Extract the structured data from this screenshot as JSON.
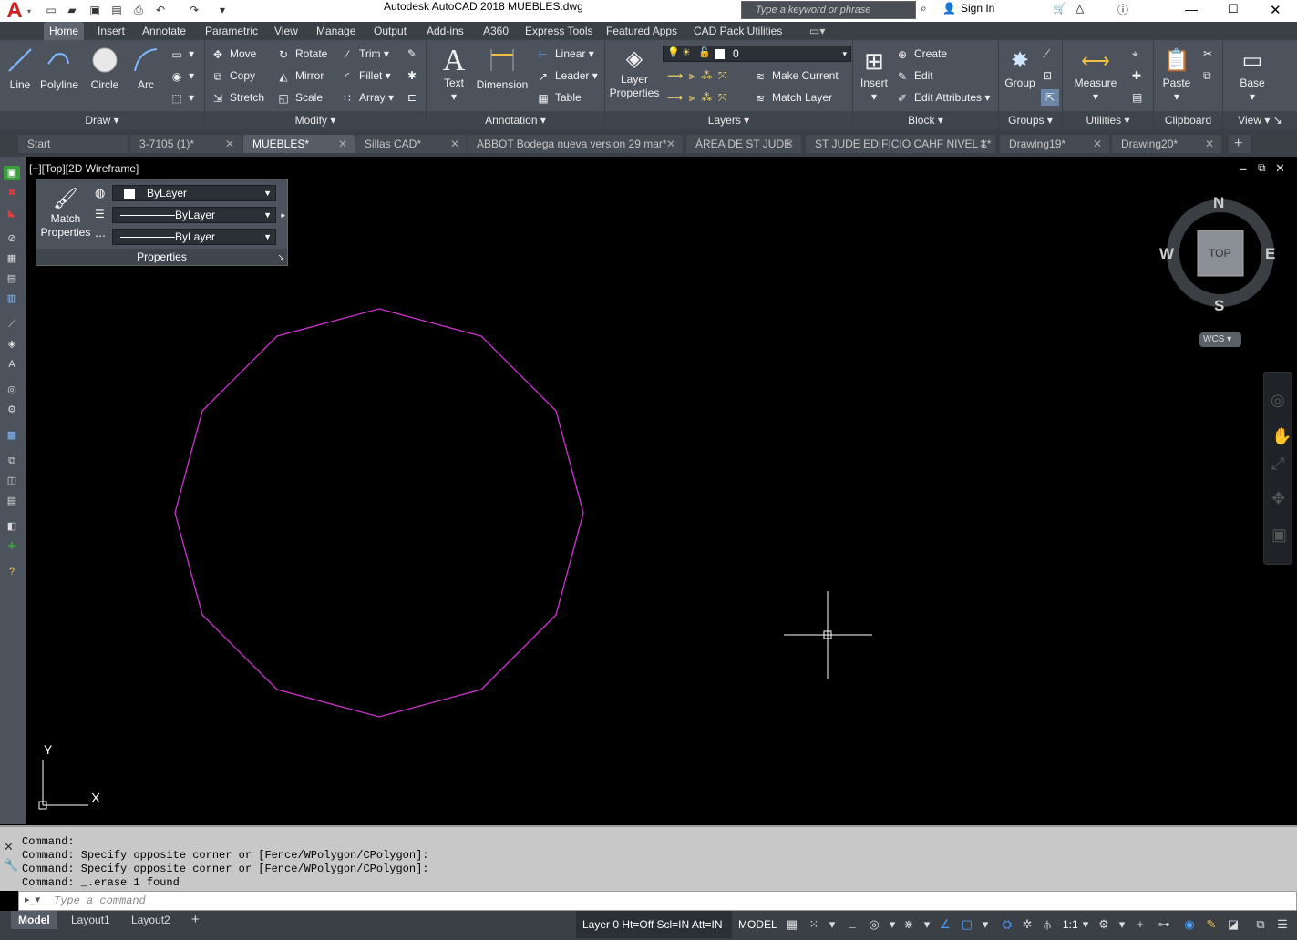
{
  "titlebar": {
    "title": "Autodesk AutoCAD 2018    MUEBLES.dwg",
    "search_placeholder": "Type a keyword or phrase",
    "sign_in": "Sign In"
  },
  "ribbon_tabs": [
    "Home",
    "Insert",
    "Annotate",
    "Parametric",
    "View",
    "Manage",
    "Output",
    "Add-ins",
    "A360",
    "Express Tools",
    "Featured Apps",
    "CAD Pack Utilities"
  ],
  "ribbon": {
    "draw": {
      "title": "Draw",
      "line": "Line",
      "polyline": "Polyline",
      "circle": "Circle",
      "arc": "Arc"
    },
    "modify": {
      "title": "Modify",
      "move": "Move",
      "rotate": "Rotate",
      "trim": "Trim",
      "copy": "Copy",
      "mirror": "Mirror",
      "fillet": "Fillet",
      "stretch": "Stretch",
      "scale": "Scale",
      "array": "Array"
    },
    "annotation": {
      "title": "Annotation",
      "text": "Text",
      "dimension": "Dimension",
      "linear": "Linear",
      "leader": "Leader",
      "table": "Table"
    },
    "layers": {
      "title": "Layers",
      "layer_properties_1": "Layer",
      "layer_properties_2": "Properties",
      "current_layer": "0",
      "make_current": "Make Current",
      "match_layer": "Match Layer"
    },
    "block": {
      "title": "Block",
      "insert": "Insert",
      "create": "Create",
      "edit": "Edit",
      "edit_attributes": "Edit Attributes"
    },
    "groups": {
      "title": "Groups",
      "group": "Group"
    },
    "utilities": {
      "title": "Utilities",
      "measure": "Measure"
    },
    "clipboard": {
      "title": "Clipboard",
      "paste": "Paste"
    },
    "view": {
      "title": "View",
      "base": "Base"
    }
  },
  "file_tabs": [
    "Start",
    "3-7105 (1)*",
    "MUEBLES*",
    "Sillas CAD*",
    "ABBOT Bodega nueva version 29 mar*",
    "ÁREA DE ST JUDE",
    "ST JUDE EDIFICIO CAHF NIVEL 1*",
    "Drawing19*",
    "Drawing20*"
  ],
  "viewport": {
    "label": "[−][Top][2D Wireframe]",
    "properties_panel": {
      "title": "Properties",
      "match_1": "Match",
      "match_2": "Properties",
      "color": "ByLayer",
      "linetype": "ByLayer",
      "lineweight": "ByLayer"
    },
    "viewcube": {
      "n": "N",
      "s": "S",
      "e": "E",
      "w": "W",
      "top": "TOP",
      "wcs": "WCS"
    },
    "ucs": {
      "x": "X",
      "y": "Y"
    },
    "shape_color": "#cc33cc"
  },
  "command": {
    "history": [
      "Command:",
      "Command: Specify opposite corner or [Fence/WPolygon/CPolygon]:",
      "Command: Specify opposite corner or [Fence/WPolygon/CPolygon]:",
      "Command: _.erase 1 found"
    ],
    "placeholder": "Type a command"
  },
  "status": {
    "layout_tabs": [
      "Model",
      "Layout1",
      "Layout2"
    ],
    "layer_info": "Layer 0 Ht=Off Scl=IN Att=IN",
    "model": "MODEL",
    "scale": "1:1"
  }
}
